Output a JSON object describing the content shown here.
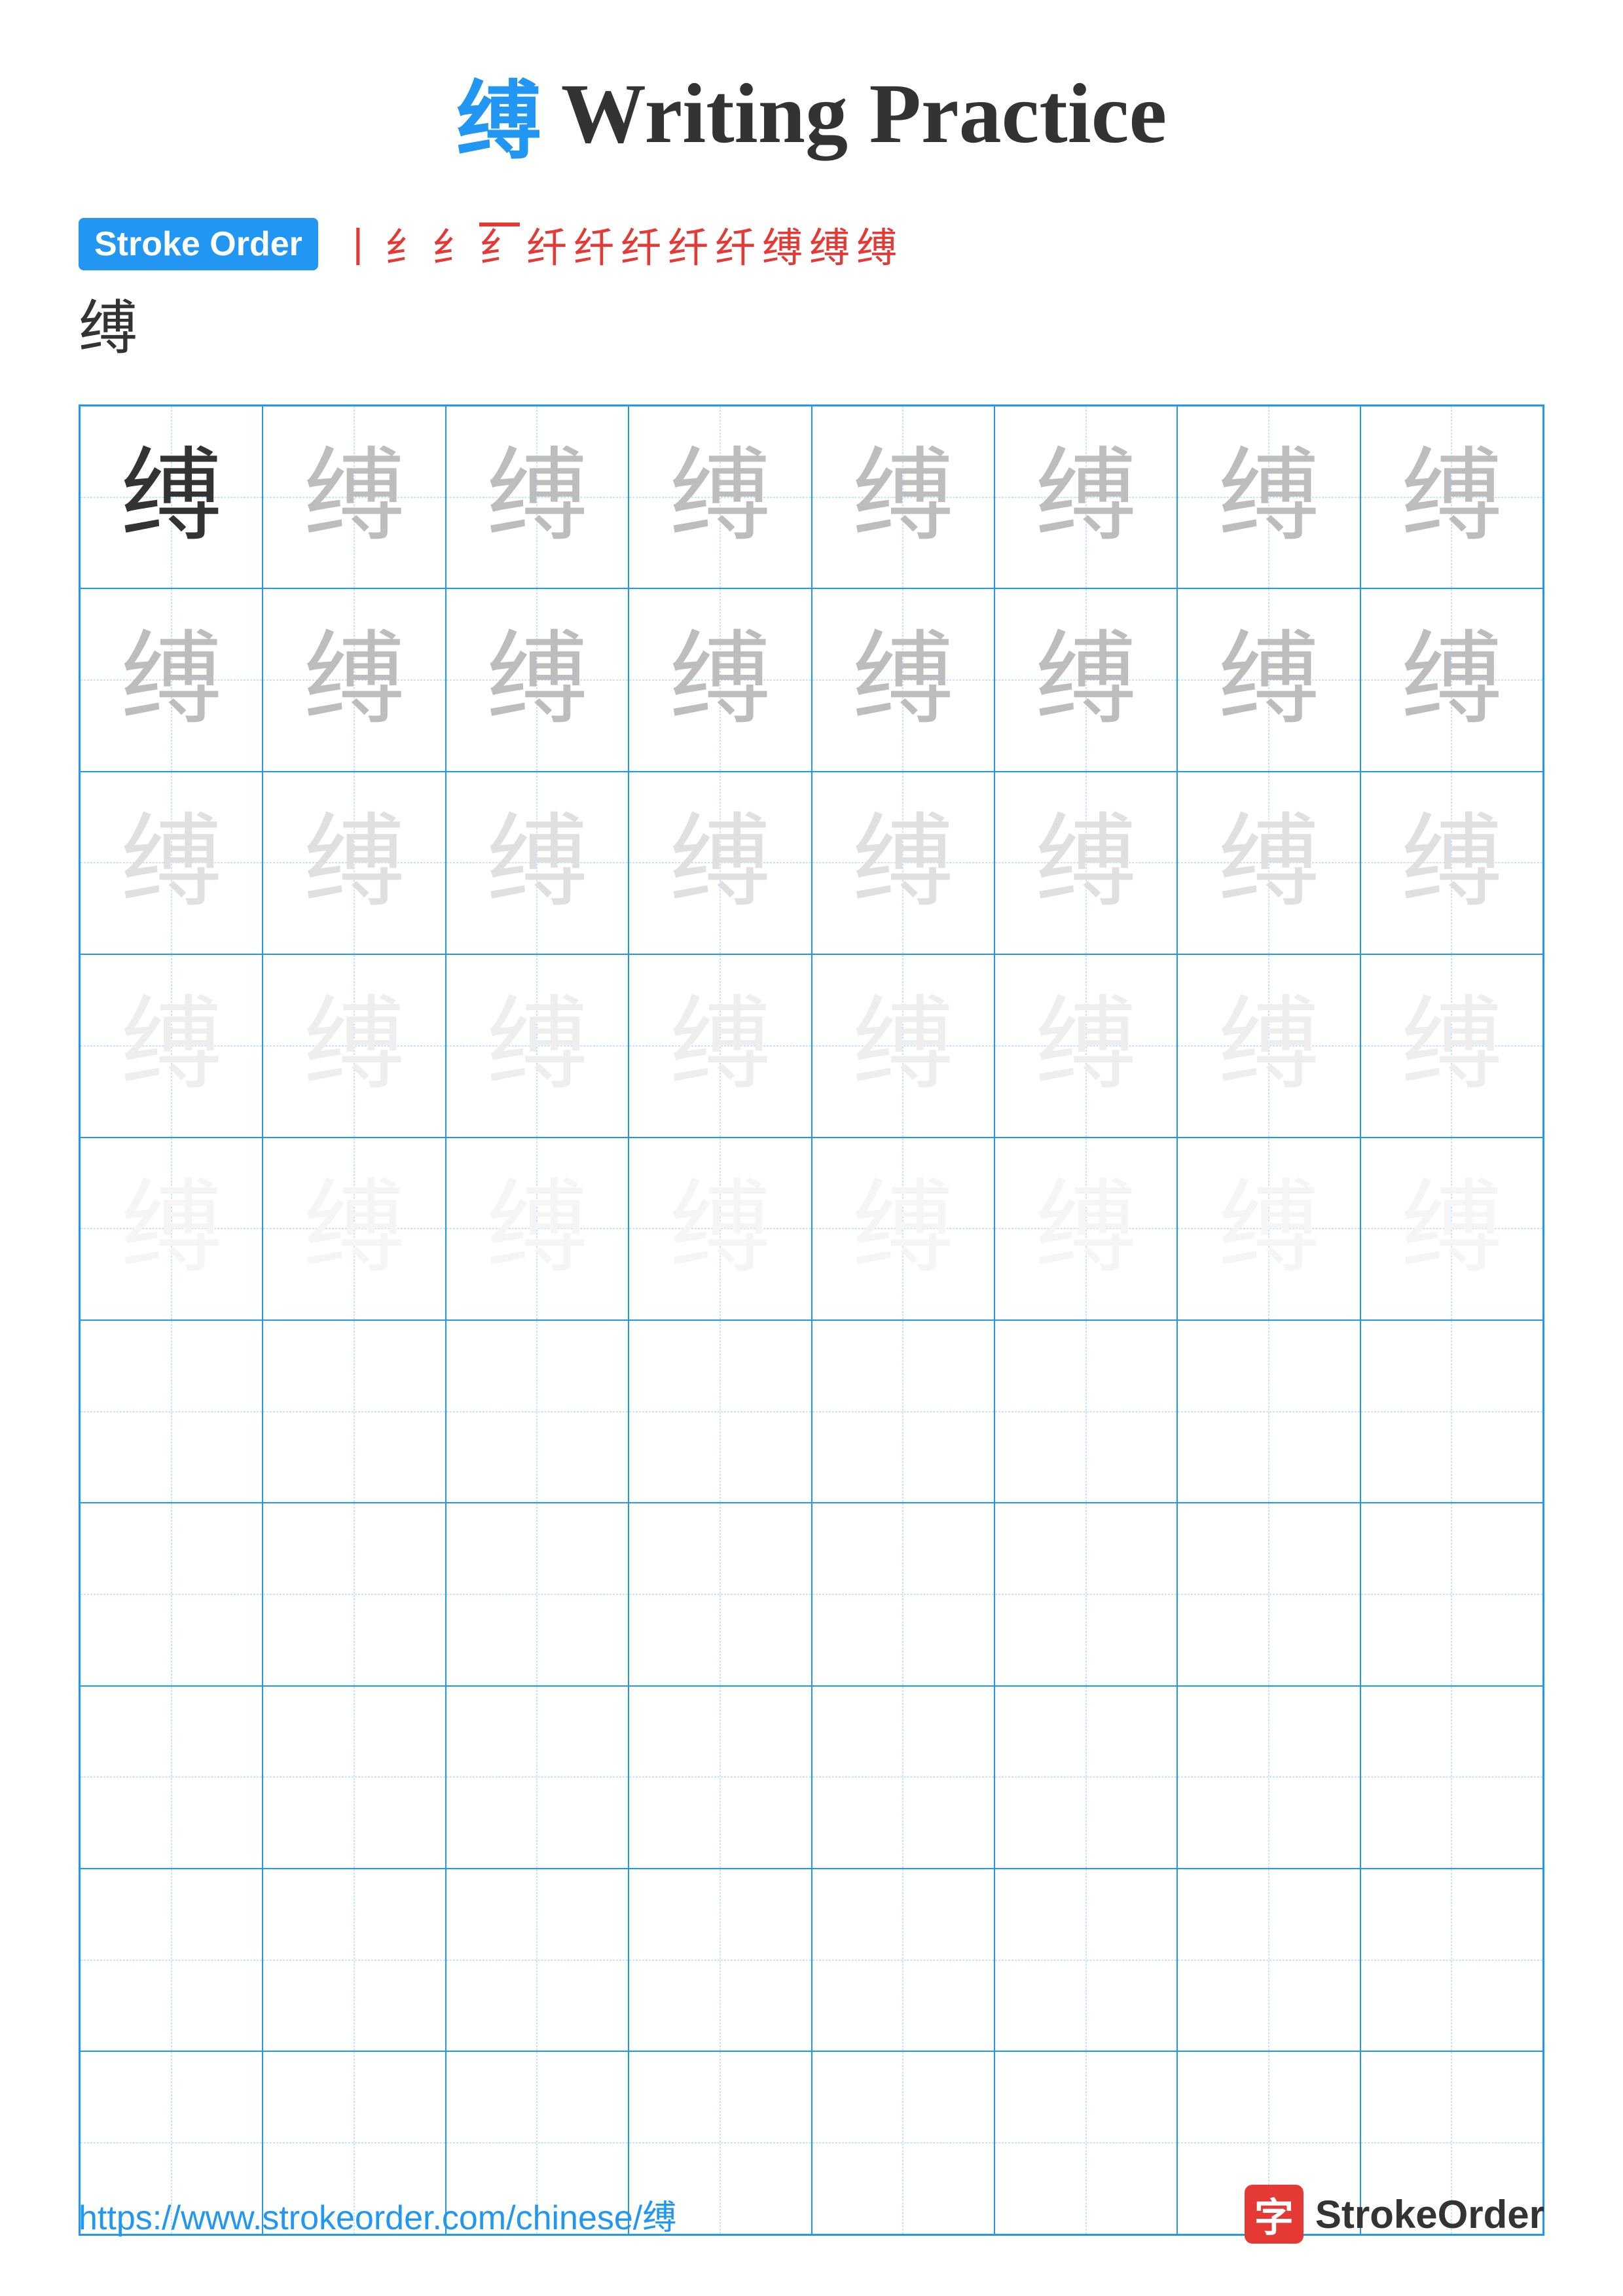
{
  "title": {
    "char": "缚",
    "label": "Writing Practice"
  },
  "strokeOrder": {
    "badge": "Stroke Order",
    "chars": [
      "丨",
      "纟",
      "纟",
      "纟⁻",
      "纤",
      "纤",
      "纤",
      "纤",
      "纤",
      "缚",
      "缚",
      "缚"
    ],
    "lastChar": "缚"
  },
  "grid": {
    "char": "缚",
    "rows": 10,
    "cols": 8,
    "charLevels": [
      [
        "dark",
        "medium",
        "medium",
        "medium",
        "medium",
        "medium",
        "medium",
        "medium"
      ],
      [
        "medium",
        "medium",
        "medium",
        "medium",
        "medium",
        "medium",
        "medium",
        "medium"
      ],
      [
        "light",
        "light",
        "light",
        "light",
        "light",
        "light",
        "light",
        "light"
      ],
      [
        "lighter",
        "lighter",
        "lighter",
        "lighter",
        "lighter",
        "lighter",
        "lighter",
        "lighter"
      ],
      [
        "lightest",
        "lightest",
        "lightest",
        "lightest",
        "lightest",
        "lightest",
        "lightest",
        "lightest"
      ],
      [
        "empty",
        "empty",
        "empty",
        "empty",
        "empty",
        "empty",
        "empty",
        "empty"
      ],
      [
        "empty",
        "empty",
        "empty",
        "empty",
        "empty",
        "empty",
        "empty",
        "empty"
      ],
      [
        "empty",
        "empty",
        "empty",
        "empty",
        "empty",
        "empty",
        "empty",
        "empty"
      ],
      [
        "empty",
        "empty",
        "empty",
        "empty",
        "empty",
        "empty",
        "empty",
        "empty"
      ],
      [
        "empty",
        "empty",
        "empty",
        "empty",
        "empty",
        "empty",
        "empty",
        "empty"
      ]
    ]
  },
  "footer": {
    "url": "https://www.strokeorder.com/chinese/缚",
    "logoChar": "字",
    "logoText": "StrokeOrder"
  }
}
